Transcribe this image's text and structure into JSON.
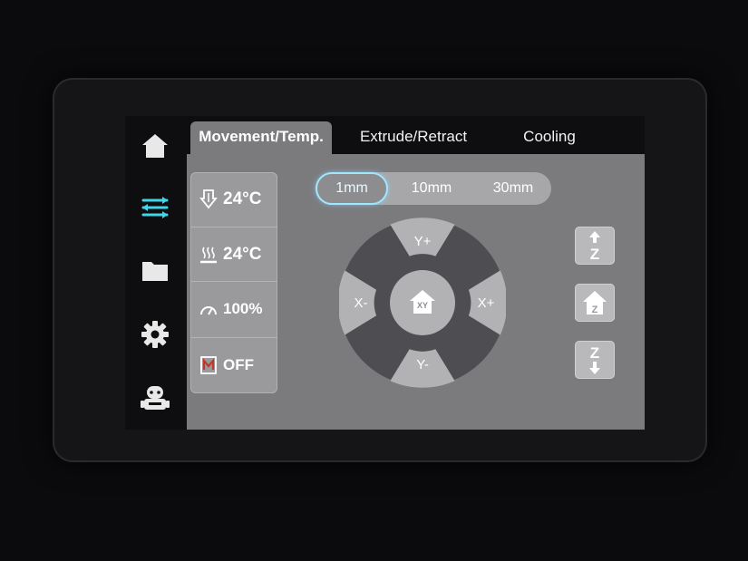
{
  "tabs": [
    {
      "label": "Movement/Temp.",
      "active": true
    },
    {
      "label": "Extrude/Retract",
      "active": false
    },
    {
      "label": "Cooling",
      "active": false
    }
  ],
  "sidebar": {
    "items": [
      {
        "icon": "home-icon",
        "active": false
      },
      {
        "icon": "sliders-icon",
        "active": true
      },
      {
        "icon": "folder-icon",
        "active": false
      },
      {
        "icon": "gear-icon",
        "active": false
      },
      {
        "icon": "robot-icon",
        "active": false
      }
    ],
    "active_color": "#3fd6e8"
  },
  "status": {
    "nozzle_temp": "24°C",
    "bed_temp": "24°C",
    "speed": "100%",
    "motors": "OFF"
  },
  "steps": {
    "options": [
      "1mm",
      "10mm",
      "30mm"
    ],
    "selected": "1mm"
  },
  "pad": {
    "y_plus": "Y+",
    "y_minus": "Y-",
    "x_minus": "X-",
    "x_plus": "X+",
    "home_xy": "XY"
  },
  "z_controls": {
    "up_label": "Z",
    "home_label": "Z",
    "down_label": "Z"
  }
}
